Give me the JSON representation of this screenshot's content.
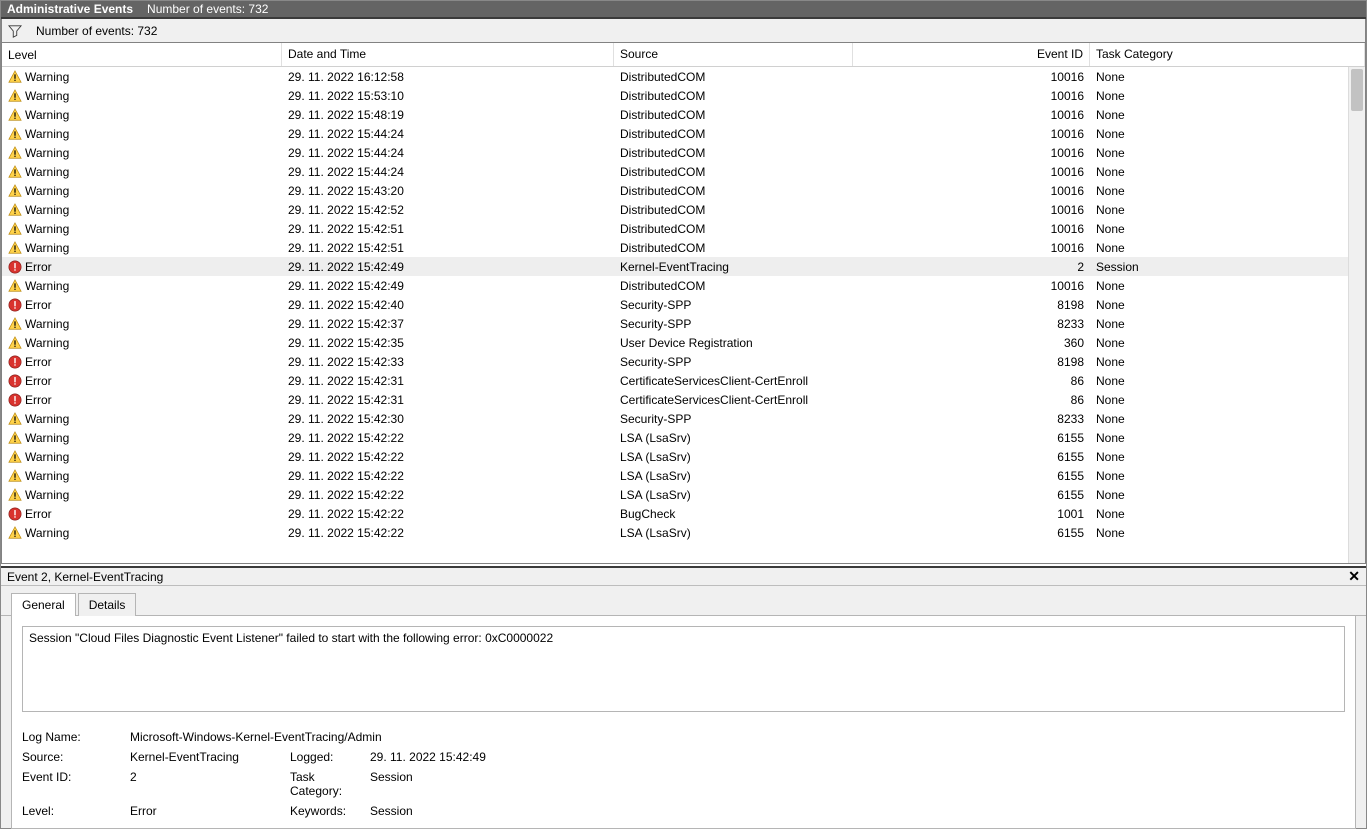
{
  "titlebar": {
    "title": "Administrative Events",
    "count_text": "Number of events: 732"
  },
  "filterbar": {
    "count_text": "Number of events: 732"
  },
  "columns": {
    "level": "Level",
    "date": "Date and Time",
    "source": "Source",
    "eventid": "Event ID",
    "taskcat": "Task Category"
  },
  "rows": [
    {
      "level": "Warning",
      "date": "29. 11. 2022 16:12:58",
      "source": "DistributedCOM",
      "id": "10016",
      "cat": "None",
      "selected": false
    },
    {
      "level": "Warning",
      "date": "29. 11. 2022 15:53:10",
      "source": "DistributedCOM",
      "id": "10016",
      "cat": "None",
      "selected": false
    },
    {
      "level": "Warning",
      "date": "29. 11. 2022 15:48:19",
      "source": "DistributedCOM",
      "id": "10016",
      "cat": "None",
      "selected": false
    },
    {
      "level": "Warning",
      "date": "29. 11. 2022 15:44:24",
      "source": "DistributedCOM",
      "id": "10016",
      "cat": "None",
      "selected": false
    },
    {
      "level": "Warning",
      "date": "29. 11. 2022 15:44:24",
      "source": "DistributedCOM",
      "id": "10016",
      "cat": "None",
      "selected": false
    },
    {
      "level": "Warning",
      "date": "29. 11. 2022 15:44:24",
      "source": "DistributedCOM",
      "id": "10016",
      "cat": "None",
      "selected": false
    },
    {
      "level": "Warning",
      "date": "29. 11. 2022 15:43:20",
      "source": "DistributedCOM",
      "id": "10016",
      "cat": "None",
      "selected": false
    },
    {
      "level": "Warning",
      "date": "29. 11. 2022 15:42:52",
      "source": "DistributedCOM",
      "id": "10016",
      "cat": "None",
      "selected": false
    },
    {
      "level": "Warning",
      "date": "29. 11. 2022 15:42:51",
      "source": "DistributedCOM",
      "id": "10016",
      "cat": "None",
      "selected": false
    },
    {
      "level": "Warning",
      "date": "29. 11. 2022 15:42:51",
      "source": "DistributedCOM",
      "id": "10016",
      "cat": "None",
      "selected": false
    },
    {
      "level": "Error",
      "date": "29. 11. 2022 15:42:49",
      "source": "Kernel-EventTracing",
      "id": "2",
      "cat": "Session",
      "selected": true
    },
    {
      "level": "Warning",
      "date": "29. 11. 2022 15:42:49",
      "source": "DistributedCOM",
      "id": "10016",
      "cat": "None",
      "selected": false
    },
    {
      "level": "Error",
      "date": "29. 11. 2022 15:42:40",
      "source": "Security-SPP",
      "id": "8198",
      "cat": "None",
      "selected": false
    },
    {
      "level": "Warning",
      "date": "29. 11. 2022 15:42:37",
      "source": "Security-SPP",
      "id": "8233",
      "cat": "None",
      "selected": false
    },
    {
      "level": "Warning",
      "date": "29. 11. 2022 15:42:35",
      "source": "User Device Registration",
      "id": "360",
      "cat": "None",
      "selected": false
    },
    {
      "level": "Error",
      "date": "29. 11. 2022 15:42:33",
      "source": "Security-SPP",
      "id": "8198",
      "cat": "None",
      "selected": false
    },
    {
      "level": "Error",
      "date": "29. 11. 2022 15:42:31",
      "source": "CertificateServicesClient-CertEnroll",
      "id": "86",
      "cat": "None",
      "selected": false
    },
    {
      "level": "Error",
      "date": "29. 11. 2022 15:42:31",
      "source": "CertificateServicesClient-CertEnroll",
      "id": "86",
      "cat": "None",
      "selected": false
    },
    {
      "level": "Warning",
      "date": "29. 11. 2022 15:42:30",
      "source": "Security-SPP",
      "id": "8233",
      "cat": "None",
      "selected": false
    },
    {
      "level": "Warning",
      "date": "29. 11. 2022 15:42:22",
      "source": "LSA (LsaSrv)",
      "id": "6155",
      "cat": "None",
      "selected": false
    },
    {
      "level": "Warning",
      "date": "29. 11. 2022 15:42:22",
      "source": "LSA (LsaSrv)",
      "id": "6155",
      "cat": "None",
      "selected": false
    },
    {
      "level": "Warning",
      "date": "29. 11. 2022 15:42:22",
      "source": "LSA (LsaSrv)",
      "id": "6155",
      "cat": "None",
      "selected": false
    },
    {
      "level": "Warning",
      "date": "29. 11. 2022 15:42:22",
      "source": "LSA (LsaSrv)",
      "id": "6155",
      "cat": "None",
      "selected": false
    },
    {
      "level": "Error",
      "date": "29. 11. 2022 15:42:22",
      "source": "BugCheck",
      "id": "1001",
      "cat": "None",
      "selected": false
    },
    {
      "level": "Warning",
      "date": "29. 11. 2022 15:42:22",
      "source": "LSA (LsaSrv)",
      "id": "6155",
      "cat": "None",
      "selected": false
    }
  ],
  "details": {
    "title": "Event 2, Kernel-EventTracing",
    "tabs": {
      "general": "General",
      "details": "Details"
    },
    "message": "Session \"Cloud Files Diagnostic Event Listener\" failed to start with the following error: 0xC0000022",
    "props": {
      "log_name_label": "Log Name:",
      "log_name_value": "Microsoft-Windows-Kernel-EventTracing/Admin",
      "source_label": "Source:",
      "source_value": "Kernel-EventTracing",
      "logged_label": "Logged:",
      "logged_value": "29. 11. 2022 15:42:49",
      "eventid_label": "Event ID:",
      "eventid_value": "2",
      "taskcat_label": "Task Category:",
      "taskcat_value": "Session",
      "level_label": "Level:",
      "level_value": "Error",
      "keywords_label": "Keywords:",
      "keywords_value": "Session"
    }
  }
}
